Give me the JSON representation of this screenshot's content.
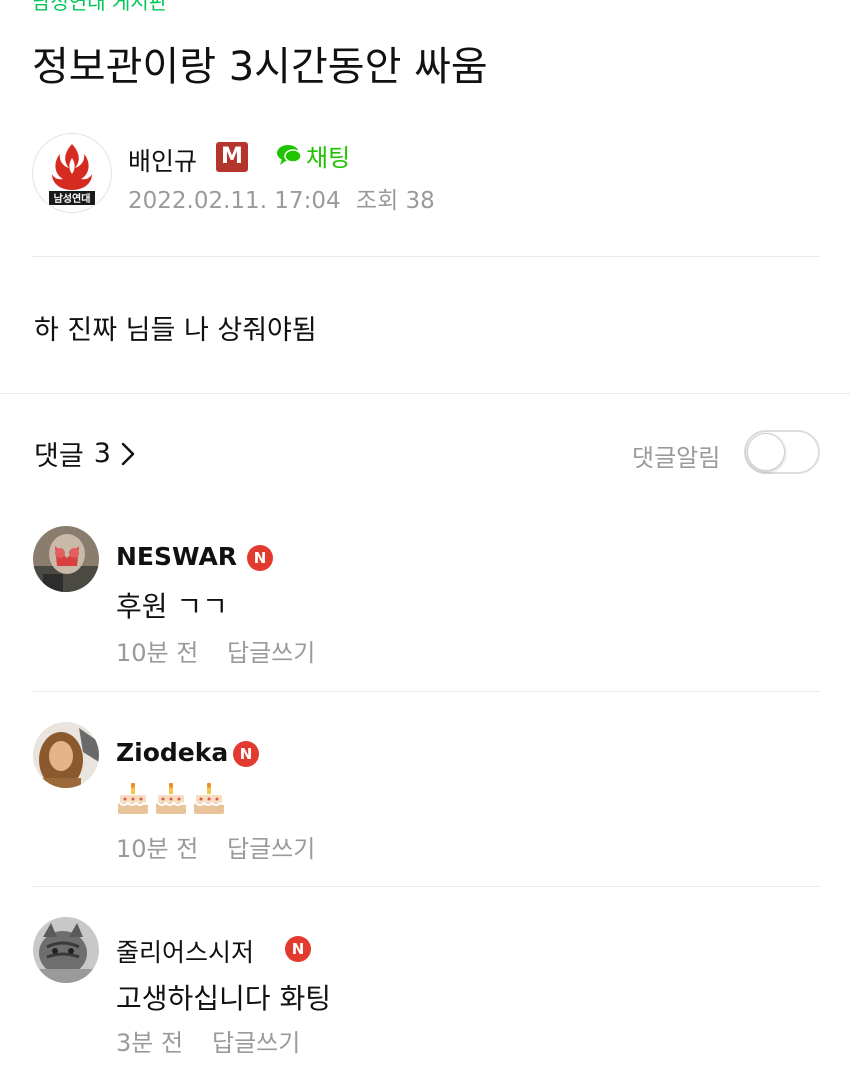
{
  "board": {
    "name": "남성연대 게시판"
  },
  "post": {
    "title": "정보관이랑 3시간동안 싸움",
    "author": {
      "name": "배인규",
      "role_badge": "M",
      "avatar_icon": "nammsung-yeondae-logo",
      "avatar_text": "남성연대"
    },
    "chat_label": "채팅",
    "date": "2022.02.11. 17:04",
    "views_label": "조회",
    "views": "38",
    "body": "하 진짜 님들 나 상줘야됨"
  },
  "comments_header": {
    "label": "댓글",
    "count": "3",
    "notify_label": "댓글알림",
    "notify_on": false
  },
  "comments": [
    {
      "author": "NESWAR",
      "badge": "N",
      "text": "후원 ㄱㄱ",
      "time": "10분 전",
      "reply": "답글쓰기"
    },
    {
      "author": "Ziodeka",
      "badge": "N",
      "text": "",
      "emoji": "birthday-cake-icon",
      "emoji_count": 3,
      "time": "10분 전",
      "reply": "답글쓰기"
    },
    {
      "author": "줄리어스시저",
      "badge": "N",
      "text": "고생하십니다 화팅",
      "time": "3분 전",
      "reply": "답글쓰기"
    }
  ],
  "colors": {
    "accent_green": "#1ec400",
    "manager_badge": "#b3352c",
    "naver_badge": "#e23a2e",
    "muted_text": "#9a9a9a"
  }
}
